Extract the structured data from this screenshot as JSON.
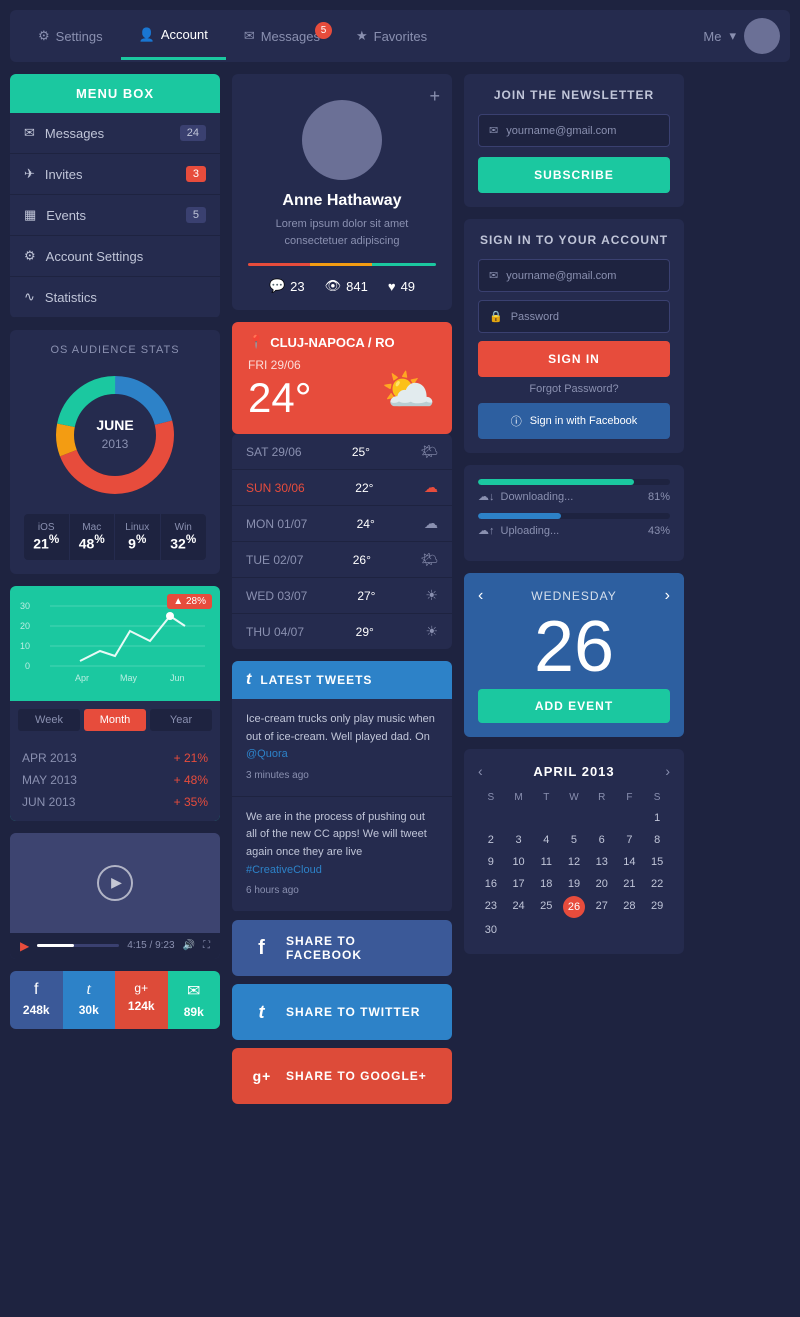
{
  "nav": {
    "items": [
      {
        "label": "Settings",
        "icon": "⚙",
        "active": false,
        "badge": null
      },
      {
        "label": "Account",
        "icon": "👤",
        "active": true,
        "badge": null
      },
      {
        "label": "Messages",
        "icon": "✉",
        "active": false,
        "badge": "5"
      },
      {
        "label": "Favorites",
        "icon": "★",
        "active": false,
        "badge": null
      }
    ],
    "user_label": "Me",
    "chevron": "▾"
  },
  "menu_box": {
    "title": "MENU BOX",
    "items": [
      {
        "label": "Messages",
        "icon": "✉",
        "badge": "24",
        "badge_type": "gray"
      },
      {
        "label": "Invites",
        "icon": "✈",
        "badge": "3",
        "badge_type": "red"
      },
      {
        "label": "Events",
        "icon": "📅",
        "badge": "5",
        "badge_type": "gray"
      },
      {
        "label": "Account Settings",
        "icon": "⚙",
        "badge": null,
        "badge_type": null
      },
      {
        "label": "Statistics",
        "icon": "〜",
        "badge": null,
        "badge_type": null
      }
    ]
  },
  "os_stats": {
    "title": "OS AUDIENCE STATS",
    "month": "JUNE",
    "year": "2013",
    "segments": [
      {
        "label": "iOS",
        "value": 21,
        "color": "#2d82c8"
      },
      {
        "label": "Mac",
        "value": 48,
        "color": "#e74c3c"
      },
      {
        "label": "Linux",
        "value": 9,
        "color": "#f39c12"
      },
      {
        "label": "Win",
        "value": 32,
        "color": "#1bc8a0"
      }
    ]
  },
  "line_chart": {
    "badge": "▲ 28%",
    "labels": [
      "Apr",
      "May",
      "Jun"
    ],
    "y_labels": [
      "30",
      "20",
      "10",
      "0"
    ],
    "periods": [
      "Week",
      "Month",
      "Year"
    ],
    "active_period": "Month",
    "stats": [
      {
        "month": "APR 2013",
        "value": "+ 21%"
      },
      {
        "month": "MAY 2013",
        "value": "+ 48%"
      },
      {
        "month": "JUN 2013",
        "value": "+ 35%"
      }
    ]
  },
  "video": {
    "time_current": "4:15",
    "time_total": "9:23"
  },
  "social": [
    {
      "icon": "f",
      "count": "248k",
      "color": "#3b5998"
    },
    {
      "icon": "t",
      "count": "30k",
      "color": "#2d82c8"
    },
    {
      "icon": "g+",
      "count": "124k",
      "color": "#dd4b39"
    },
    {
      "icon": "✉",
      "count": "89k",
      "color": "#1bc8a0"
    }
  ],
  "profile": {
    "name": "Anne Hathaway",
    "bio": "Lorem ipsum dolor sit amet consectetuer adipiscing",
    "comments": "23",
    "views": "841",
    "likes": "49"
  },
  "weather": {
    "location": "CLUJ-NAPOCA / RO",
    "day": "FRI 29/06",
    "temp": "24°",
    "icon": "⛅",
    "forecast": [
      {
        "day": "SAT 29/06",
        "temp": "25°",
        "icon": "🌤",
        "highlight": false
      },
      {
        "day": "SUN 30/06",
        "temp": "22°",
        "icon": "☁",
        "highlight": true
      },
      {
        "day": "MON 01/07",
        "temp": "24°",
        "icon": "☁",
        "highlight": false
      },
      {
        "day": "TUE 02/07",
        "temp": "26°",
        "icon": "🌤",
        "highlight": false
      },
      {
        "day": "WED 03/07",
        "temp": "27°",
        "icon": "☀",
        "highlight": false
      },
      {
        "day": "THU 04/07",
        "temp": "29°",
        "icon": "☀",
        "highlight": false
      }
    ]
  },
  "tweets": {
    "header": "LATEST TWEETS",
    "items": [
      {
        "text": "Ice-cream trucks only play music when out of ice-cream. Well played dad. On ",
        "link": "@Quora",
        "time": "3 minutes ago"
      },
      {
        "text": "We are in the process of pushing out all of the new CC apps! We will tweet again once they are live ",
        "link": "#CreativeCloud",
        "time": "6 hours ago"
      }
    ]
  },
  "share_buttons": [
    {
      "label": "SHARE TO FACEBOOK",
      "icon": "f",
      "color": "#3b5998"
    },
    {
      "label": "SHARE TO TWITTER",
      "icon": "t",
      "color": "#2d82c8"
    },
    {
      "label": "SHARE TO GOOGLE+",
      "icon": "g+",
      "color": "#dd4b39"
    }
  ],
  "newsletter": {
    "title": "JOIN THE NEWSLETTER",
    "placeholder": "yourname@gmail.com",
    "btn_label": "SUBSCRIBE"
  },
  "signin": {
    "title": "SIGN IN TO YOUR ACCOUNT",
    "email_placeholder": "yourname@gmail.com",
    "password_placeholder": "Password",
    "signin_btn": "SIGN IN",
    "forgot_pw": "Forgot Password?",
    "fb_signin": "Sign in with Facebook"
  },
  "transfers": [
    {
      "label": "Downloading...",
      "value": "81%",
      "fill": 81,
      "color": "#1bc8a0"
    },
    {
      "label": "Uploading...",
      "value": "43%",
      "fill": 43,
      "color": "#2d82c8"
    }
  ],
  "calendar_big": {
    "weekday": "WEDNESDAY",
    "day": "26",
    "btn_label": "ADD EVENT"
  },
  "calendar_small": {
    "title": "APRIL 2013",
    "days_of_week": [
      "S",
      "M",
      "T",
      "W",
      "R",
      "F",
      "S"
    ],
    "weeks": [
      [
        "",
        "",
        "",
        "",
        "",
        "",
        "1"
      ],
      [
        "2",
        "3",
        "4",
        "5",
        "6",
        "7",
        "8"
      ],
      [
        "9",
        "10",
        "11",
        "12",
        "13",
        "14",
        "15"
      ],
      [
        "16",
        "17",
        "18",
        "19",
        "20",
        "21",
        "22"
      ],
      [
        "23",
        "24",
        "25",
        "26",
        "27",
        "28",
        "29"
      ],
      [
        "30",
        "",
        "",
        "",
        "",
        "",
        ""
      ]
    ],
    "today": "26"
  }
}
